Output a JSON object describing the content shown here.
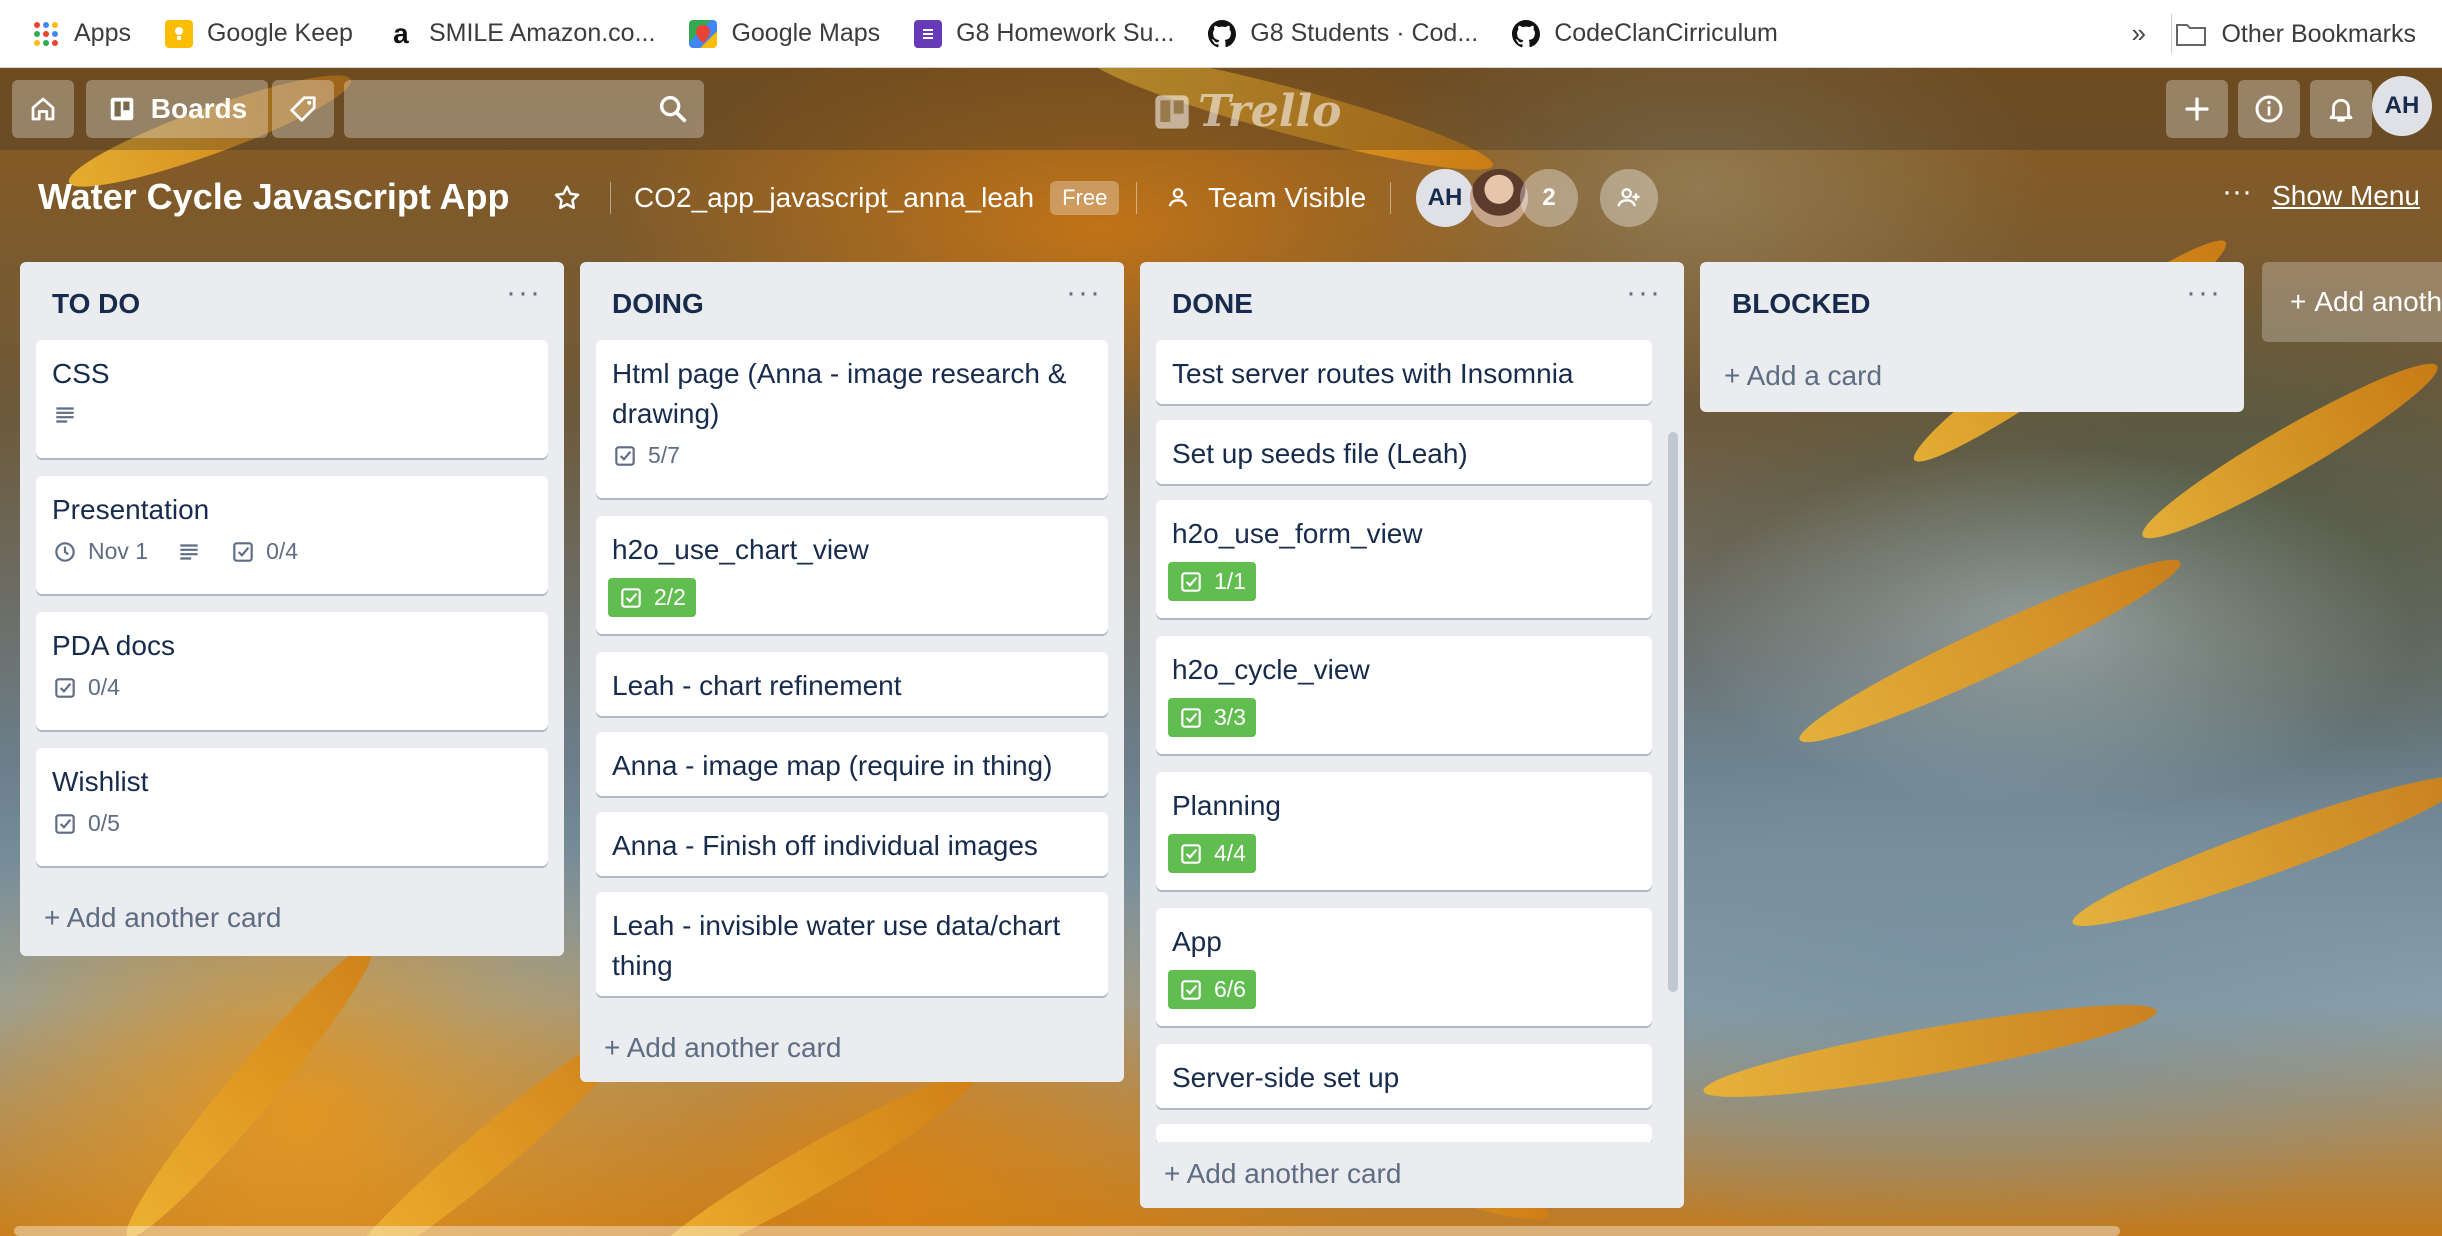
{
  "bookmarks": [
    {
      "label": "Apps",
      "icon": "apps-grid-icon"
    },
    {
      "label": "Google Keep",
      "icon": "google-keep-icon"
    },
    {
      "label": "SMILE Amazon.co...",
      "icon": "amazon-icon"
    },
    {
      "label": "Google Maps",
      "icon": "google-maps-icon"
    },
    {
      "label": "G8 Homework Su...",
      "icon": "google-forms-icon"
    },
    {
      "label": "G8 Students · Cod...",
      "icon": "github-icon"
    },
    {
      "label": "CodeClanCirriculum",
      "icon": "github-icon"
    }
  ],
  "bookmarks_more": "»",
  "other_bookmarks": "Other Bookmarks",
  "header": {
    "boards_label": "Boards",
    "logo_text": "Trello",
    "user_initials": "AH"
  },
  "board": {
    "title": "Water Cycle Javascript App",
    "team": "CO2_app_javascript_anna_leah",
    "plan_badge": "Free",
    "visibility": "Team Visible",
    "members": [
      "AH",
      "",
      "2"
    ],
    "show_menu": "Show Menu",
    "menu_dots": "···"
  },
  "lists": [
    {
      "title": "TO DO",
      "cards": [
        {
          "title": "CSS",
          "description": true
        },
        {
          "title": "Presentation",
          "due": "Nov 1",
          "description": true,
          "checklist": "0/4"
        },
        {
          "title": "PDA docs",
          "checklist": "0/4"
        },
        {
          "title": "Wishlist",
          "checklist": "0/5"
        }
      ],
      "add_label": "Add another card"
    },
    {
      "title": "DOING",
      "cards": [
        {
          "title": "Html page (Anna - image research & drawing)",
          "checklist": "5/7"
        },
        {
          "title": "h2o_use_chart_view",
          "checklist": "2/2",
          "complete": true
        },
        {
          "title": "Leah - chart refinement"
        },
        {
          "title": "Anna - image map (require in thing)"
        },
        {
          "title": "Anna - Finish off individual images"
        },
        {
          "title": "Leah - invisible water use data/chart thing"
        }
      ],
      "add_label": "Add another card"
    },
    {
      "title": "DONE",
      "cards": [
        {
          "title": "Test server routes with Insomnia"
        },
        {
          "title": "Set up seeds file (Leah)"
        },
        {
          "title": "h2o_use_form_view",
          "checklist": "1/1",
          "complete": true
        },
        {
          "title": "h2o_cycle_view",
          "checklist": "3/3",
          "complete": true
        },
        {
          "title": "Planning",
          "checklist": "4/4",
          "complete": true
        },
        {
          "title": "App",
          "checklist": "6/6",
          "complete": true
        },
        {
          "title": "Server-side set up"
        }
      ],
      "add_label": "Add another card"
    },
    {
      "title": "BLOCKED",
      "cards": [],
      "add_label": "Add a card"
    }
  ],
  "add_list_label": "Add anoth",
  "colors": {
    "list_bg": "#ebecf0",
    "complete_badge": "#61bd4f",
    "text": "#172b4d",
    "muted": "#5e6c84"
  }
}
